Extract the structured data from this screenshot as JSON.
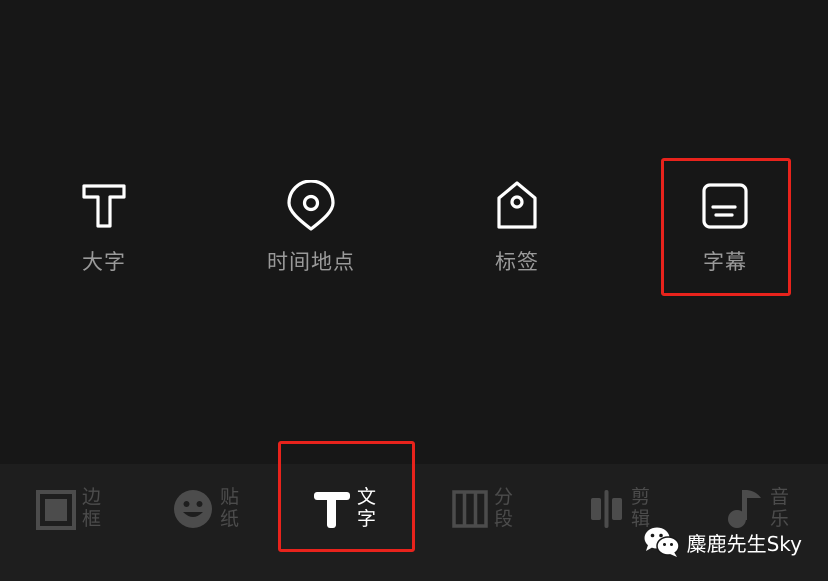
{
  "options": [
    {
      "label": "大字",
      "icon": "text-icon"
    },
    {
      "label": "时间地点",
      "icon": "location-pin-icon"
    },
    {
      "label": "标签",
      "icon": "tag-icon"
    },
    {
      "label": "字幕",
      "icon": "subtitle-icon"
    }
  ],
  "tabs": [
    {
      "label": "边框",
      "icon": "frame-icon"
    },
    {
      "label": "贴纸",
      "icon": "sticker-smiley-icon"
    },
    {
      "label": "文字",
      "icon": "text-icon",
      "active": true
    },
    {
      "label": "分段",
      "icon": "segment-icon"
    },
    {
      "label": "剪辑",
      "icon": "edit-split-icon"
    },
    {
      "label": "音乐",
      "icon": "music-note-icon"
    }
  ],
  "watermark": {
    "text": "麋鹿先生Sky",
    "icon": "wechat-icon"
  },
  "colors": {
    "highlight": "#e8231c",
    "active": "#ffffff",
    "inactive": "#4c4c4c",
    "option_label": "#9a9a9a"
  }
}
